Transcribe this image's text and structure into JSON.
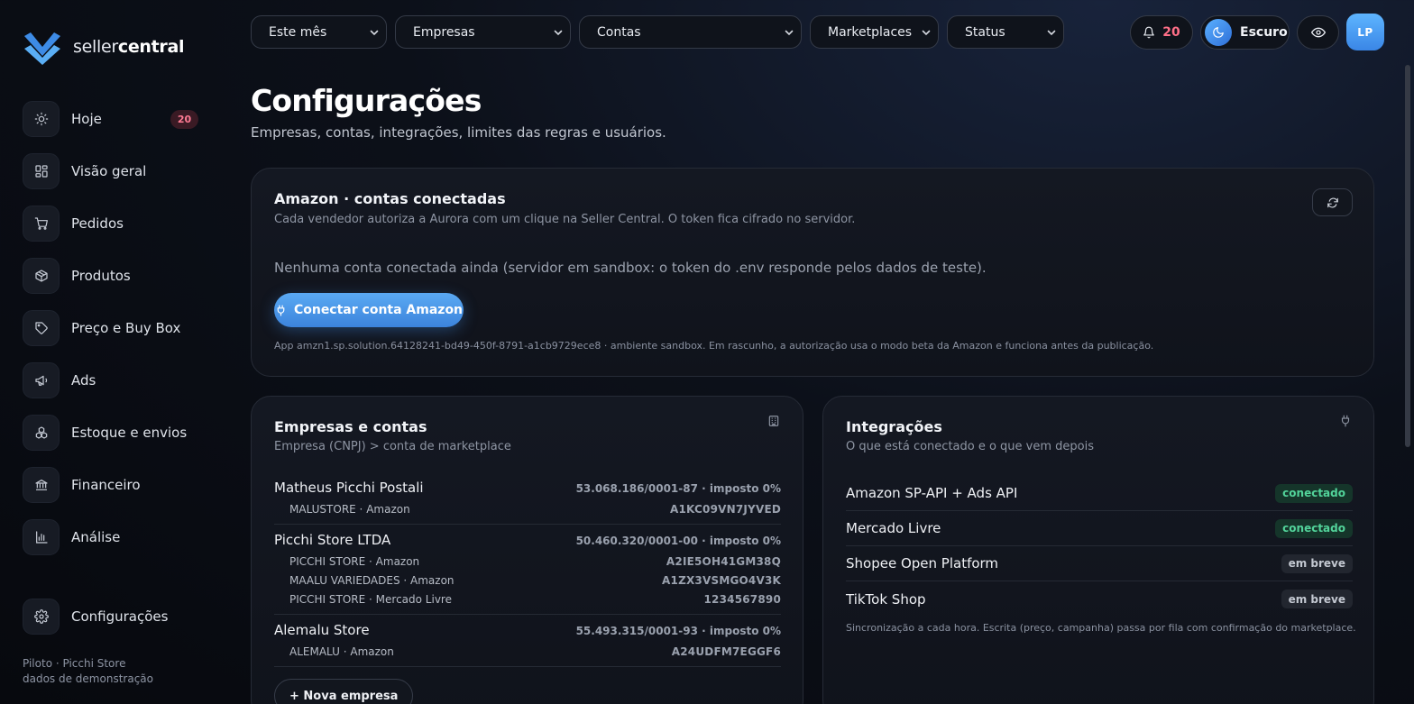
{
  "brand": {
    "name_light": "seller",
    "name_bold": "central"
  },
  "nav": {
    "items": [
      {
        "label": "Hoje",
        "icon": "sun-icon",
        "badge": "20"
      },
      {
        "label": "Visão geral",
        "icon": "grid-icon"
      },
      {
        "label": "Pedidos",
        "icon": "cart-icon"
      },
      {
        "label": "Produtos",
        "icon": "box-icon"
      },
      {
        "label": "Preço e Buy Box",
        "icon": "tag-icon"
      },
      {
        "label": "Ads",
        "icon": "megaphone-icon"
      },
      {
        "label": "Estoque e envios",
        "icon": "boxes-icon"
      },
      {
        "label": "Financeiro",
        "icon": "bank-icon"
      },
      {
        "label": "Análise",
        "icon": "bar-chart-icon"
      }
    ],
    "settings": {
      "label": "Configurações",
      "icon": "gear-icon"
    }
  },
  "sidebar_footer": {
    "line1": "Piloto · Picchi Store",
    "line2": "dados de demonstração"
  },
  "filters": {
    "period": "Este mês",
    "companies": "Empresas",
    "accounts": "Contas",
    "marketplaces": "Marketplaces",
    "status": "Status"
  },
  "topbar": {
    "notifications_count": "20",
    "theme_label": "Escuro",
    "avatar_initials": "LP"
  },
  "page": {
    "title": "Configurações",
    "subtitle": "Empresas, contas, integrações, limites das regras e usuários."
  },
  "amazon_card": {
    "title": "Amazon · contas conectadas",
    "subtitle": "Cada vendedor autoriza a Aurora com um clique na Seller Central. O token fica cifrado no servidor.",
    "empty_message": "Nenhuma conta conectada ainda (servidor em sandbox: o token do .env responde pelos dados de teste).",
    "connect_label": "Conectar conta Amazon",
    "app_note": "App amzn1.sp.solution.64128241-bd49-450f-8791-a1cb9729ece8 · ambiente sandbox. Em rascunho, a autorização usa o modo beta da Amazon e funciona antes da publicação."
  },
  "companies_card": {
    "title": "Empresas e contas",
    "subtitle": "Empresa (CNPJ) > conta de marketplace",
    "companies": [
      {
        "name": "Matheus Picchi Postali",
        "cnpj": "53.068.186/0001-87 · imposto 0%",
        "accounts": [
          {
            "name": "MALUSTORE · Amazon",
            "id": "A1KC09VN7JYVED"
          }
        ]
      },
      {
        "name": "Picchi Store LTDA",
        "cnpj": "50.460.320/0001-00 · imposto 0%",
        "accounts": [
          {
            "name": "PICCHI STORE · Amazon",
            "id": "A2IE5OH41GM38Q"
          },
          {
            "name": "MAALU VARIEDADES · Amazon",
            "id": "A1ZX3VSMGO4V3K"
          },
          {
            "name": "PICCHI STORE · Mercado Livre",
            "id": "1234567890"
          }
        ]
      },
      {
        "name": "Alemalu Store",
        "cnpj": "55.493.315/0001-93 · imposto 0%",
        "accounts": [
          {
            "name": "ALEMALU · Amazon",
            "id": "A24UDFM7EGGF6"
          }
        ]
      }
    ],
    "new_company_label": "+ Nova empresa"
  },
  "integrations_card": {
    "title": "Integrações",
    "subtitle": "O que está conectado e o que vem depois",
    "items": [
      {
        "name": "Amazon SP-API + Ads API",
        "status": "conectado",
        "state": "ok"
      },
      {
        "name": "Mercado Livre",
        "status": "conectado",
        "state": "ok"
      },
      {
        "name": "Shopee Open Platform",
        "status": "em breve",
        "state": "soon"
      },
      {
        "name": "TikTok Shop",
        "status": "em breve",
        "state": "soon"
      }
    ],
    "note": "Sincronização a cada hora. Escrita (preço, campanha) passa por fila com confirmação do marketplace."
  },
  "colors": {
    "accent": "#4a96e8",
    "badge_red": "#ff7b94",
    "status_ok": "#52d39a"
  }
}
